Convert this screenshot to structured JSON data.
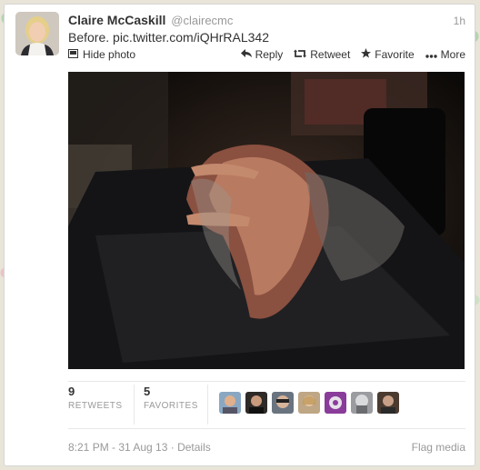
{
  "tweet": {
    "author_name": "Claire McCaskill",
    "author_handle": "@clairecmc",
    "time_ago": "1h",
    "text_prefix": "Before. ",
    "text_link": "pic.twitter.com/iQHrRAL342",
    "hide_photo_label": "Hide photo",
    "actions": {
      "reply": "Reply",
      "retweet": "Retweet",
      "favorite": "Favorite",
      "more": "More"
    },
    "stats": {
      "retweets_count": "9",
      "retweets_label": "RETWEETS",
      "favorites_count": "5",
      "favorites_label": "FAVORITES"
    },
    "timestamp": "8:21 PM - 31 Aug 13 · ",
    "details_label": "Details",
    "flag_label": "Flag media"
  },
  "icons": [
    "hide-photo-icon",
    "reply-icon",
    "retweet-icon",
    "favorite-icon",
    "more-icon"
  ]
}
